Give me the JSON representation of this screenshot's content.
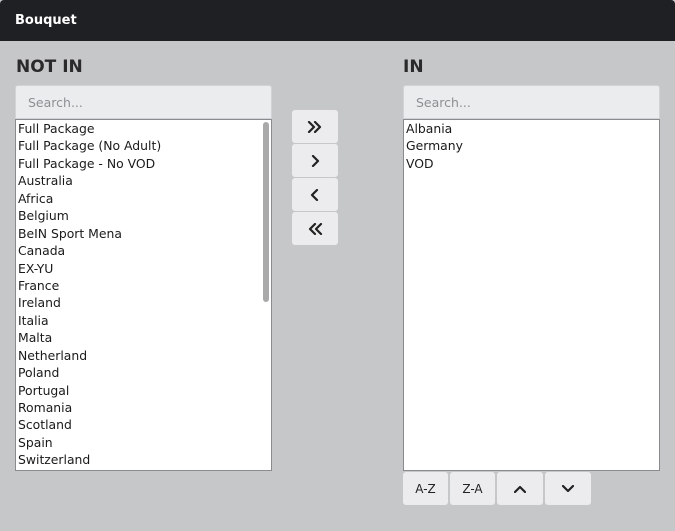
{
  "window": {
    "title": "Bouquet"
  },
  "not_in": {
    "heading": "NOT IN",
    "search_placeholder": "Search...",
    "items": [
      "Full Package",
      "Full Package (No Adult)",
      "Full Package - No VOD",
      "Australia",
      "Africa",
      "Belgium",
      "BeIN Sport Mena",
      "Canada",
      "EX-YU",
      "France",
      "Ireland",
      "Italia",
      "Malta",
      "Netherland",
      "Poland",
      "Portugal",
      "Romania",
      "Scotland",
      "Spain",
      "Switzerland"
    ]
  },
  "in": {
    "heading": "IN",
    "search_placeholder": "Search...",
    "items": [
      "Albania",
      "Germany",
      "VOD"
    ]
  },
  "transfer_buttons": {
    "add_all_icon": "double-chevron-right-icon",
    "add_icon": "chevron-right-icon",
    "remove_icon": "chevron-left-icon",
    "remove_all_icon": "double-chevron-left-icon"
  },
  "sort_buttons": {
    "az_label": "A-Z",
    "za_label": "Z-A",
    "move_up_icon": "chevron-up-icon",
    "move_down_icon": "chevron-down-icon"
  }
}
